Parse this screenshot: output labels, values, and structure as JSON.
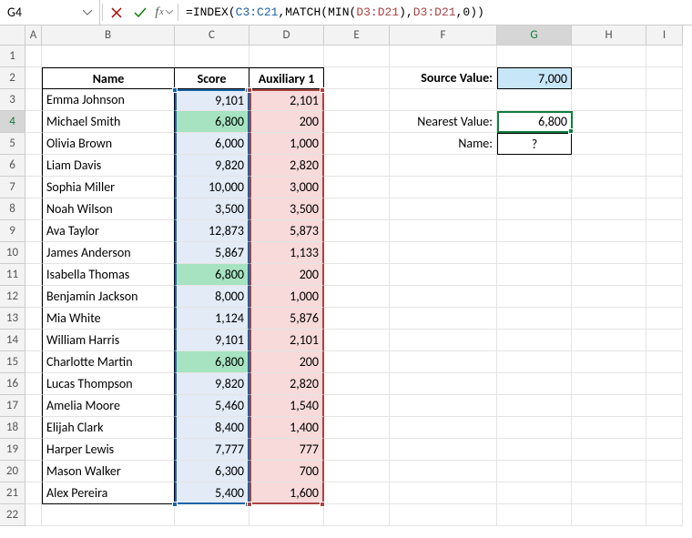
{
  "name_box": "G4",
  "formula_tokens": {
    "eq": "=",
    "index": "INDEX",
    "op": "(",
    "ref_c": "C3:C21",
    "cm1": ",",
    "match": "MATCH",
    "op2": "(",
    "min": "MIN",
    "op3": "(",
    "ref_d1": "D3:D21",
    "cp1": ")",
    "cm2": ",",
    "ref_d2": "D3:D21",
    "cm3": ",",
    "zero": "0",
    "cp2": ")",
    "cp3": ")"
  },
  "headers": {
    "B": "Name",
    "C": "Score",
    "D": "Auxiliary 1"
  },
  "labels": {
    "source": "Source Value:",
    "nearest": "Nearest Value:",
    "name": "Name:"
  },
  "source_value": "7,000",
  "nearest_value": "6,800",
  "name_value": "?",
  "cols": [
    "A",
    "B",
    "C",
    "D",
    "E",
    "F",
    "G",
    "H",
    "I"
  ],
  "rows": [
    {
      "n": "1"
    },
    {
      "n": "2"
    },
    {
      "n": "3",
      "name": "Emma Johnson",
      "score": "9,101",
      "aux": "2,101",
      "hl": false
    },
    {
      "n": "4",
      "name": "Michael Smith",
      "score": "6,800",
      "aux": "200",
      "hl": true
    },
    {
      "n": "5",
      "name": "Olivia Brown",
      "score": "6,000",
      "aux": "1,000",
      "hl": false
    },
    {
      "n": "6",
      "name": "Liam Davis",
      "score": "9,820",
      "aux": "2,820",
      "hl": false
    },
    {
      "n": "7",
      "name": "Sophia Miller",
      "score": "10,000",
      "aux": "3,000",
      "hl": false
    },
    {
      "n": "8",
      "name": "Noah Wilson",
      "score": "3,500",
      "aux": "3,500",
      "hl": false
    },
    {
      "n": "9",
      "name": "Ava Taylor",
      "score": "12,873",
      "aux": "5,873",
      "hl": false
    },
    {
      "n": "10",
      "name": "James Anderson",
      "score": "5,867",
      "aux": "1,133",
      "hl": false
    },
    {
      "n": "11",
      "name": "Isabella Thomas",
      "score": "6,800",
      "aux": "200",
      "hl": true
    },
    {
      "n": "12",
      "name": "Benjamin Jackson",
      "score": "8,000",
      "aux": "1,000",
      "hl": false
    },
    {
      "n": "13",
      "name": "Mia White",
      "score": "1,124",
      "aux": "5,876",
      "hl": false
    },
    {
      "n": "14",
      "name": "William Harris",
      "score": "9,101",
      "aux": "2,101",
      "hl": false
    },
    {
      "n": "15",
      "name": "Charlotte Martin",
      "score": "6,800",
      "aux": "200",
      "hl": true
    },
    {
      "n": "16",
      "name": "Lucas Thompson",
      "score": "9,820",
      "aux": "2,820",
      "hl": false
    },
    {
      "n": "17",
      "name": "Amelia Moore",
      "score": "5,460",
      "aux": "1,540",
      "hl": false
    },
    {
      "n": "18",
      "name": "Elijah Clark",
      "score": "8,400",
      "aux": "1,400",
      "hl": false
    },
    {
      "n": "19",
      "name": "Harper Lewis",
      "score": "7,777",
      "aux": "777",
      "hl": false
    },
    {
      "n": "20",
      "name": "Mason Walker",
      "score": "6,300",
      "aux": "700",
      "hl": false
    },
    {
      "n": "21",
      "name": "Alex Pereira",
      "score": "5,400",
      "aux": "1,600",
      "hl": false
    },
    {
      "n": "22"
    }
  ]
}
